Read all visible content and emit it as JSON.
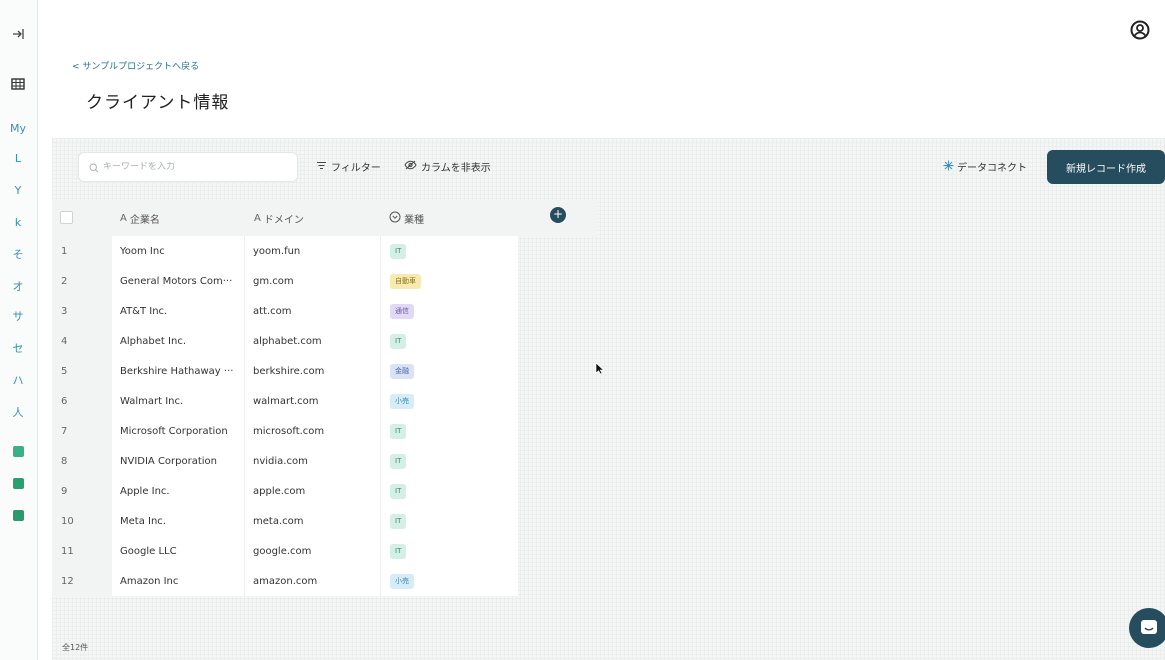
{
  "sidebar": {
    "items": [
      {
        "label": "My",
        "color": "#3a8fb0"
      },
      {
        "label": "L",
        "color": "#3a8fb0"
      },
      {
        "label": "Y",
        "color": "#3a8fb0"
      },
      {
        "label": "k",
        "color": "#3a8fb0"
      },
      {
        "label": "そ",
        "color": "#3a8fb0"
      },
      {
        "label": "オ",
        "color": "#3a8fb0"
      },
      {
        "label": "サ",
        "color": "#3a8fb0"
      },
      {
        "label": "セ",
        "color": "#3a8fb0"
      },
      {
        "label": "ハ",
        "color": "#3a8fb0"
      },
      {
        "label": "人",
        "color": "#3a8fb0"
      }
    ],
    "squares": [
      "#3ab08a",
      "#2aa06f",
      "#2a9a6a"
    ]
  },
  "header": {
    "back_link": "< サンプルプロジェクトへ戻る",
    "title": "クライアント情報"
  },
  "toolbar": {
    "search_placeholder": "キーワードを入力",
    "filter_label": "フィルター",
    "hide_columns_label": "カラムを非表示",
    "data_connect_label": "データコネクト",
    "new_record_label": "新規レコード作成"
  },
  "table": {
    "columns": [
      "企業名",
      "ドメイン",
      "業種"
    ],
    "rows": [
      {
        "num": "1",
        "name": "Yoom Inc",
        "domain": "yoom.fun",
        "industry": "IT",
        "tag_bg": "#d4efe6",
        "tag_fg": "#3a8a73"
      },
      {
        "num": "2",
        "name": "General Motors Com···",
        "domain": "gm.com",
        "industry": "自動車",
        "tag_bg": "#f6eab0",
        "tag_fg": "#8a7520"
      },
      {
        "num": "3",
        "name": "AT&T Inc.",
        "domain": "att.com",
        "industry": "通信",
        "tag_bg": "#e2daf4",
        "tag_fg": "#6b55a8"
      },
      {
        "num": "4",
        "name": "Alphabet Inc.",
        "domain": "alphabet.com",
        "industry": "IT",
        "tag_bg": "#d4efe6",
        "tag_fg": "#3a8a73"
      },
      {
        "num": "5",
        "name": "Berkshire Hathaway ···",
        "domain": "berkshire.com",
        "industry": "金融",
        "tag_bg": "#d9e3f4",
        "tag_fg": "#4a66a0"
      },
      {
        "num": "6",
        "name": "Walmart Inc.",
        "domain": "walmart.com",
        "industry": "小売",
        "tag_bg": "#d6ecf6",
        "tag_fg": "#3a86a6"
      },
      {
        "num": "7",
        "name": "Microsoft Corporation",
        "domain": "microsoft.com",
        "industry": "IT",
        "tag_bg": "#d4efe6",
        "tag_fg": "#3a8a73"
      },
      {
        "num": "8",
        "name": "NVIDIA Corporation",
        "domain": "nvidia.com",
        "industry": "IT",
        "tag_bg": "#d4efe6",
        "tag_fg": "#3a8a73"
      },
      {
        "num": "9",
        "name": "Apple Inc.",
        "domain": "apple.com",
        "industry": "IT",
        "tag_bg": "#d4efe6",
        "tag_fg": "#3a8a73"
      },
      {
        "num": "10",
        "name": "Meta Inc.",
        "domain": "meta.com",
        "industry": "IT",
        "tag_bg": "#d4efe6",
        "tag_fg": "#3a8a73"
      },
      {
        "num": "11",
        "name": "Google LLC",
        "domain": "google.com",
        "industry": "IT",
        "tag_bg": "#d4efe6",
        "tag_fg": "#3a8a73"
      },
      {
        "num": "12",
        "name": "Amazon Inc",
        "domain": "amazon.com",
        "industry": "小売",
        "tag_bg": "#d6ecf6",
        "tag_fg": "#3a86a6"
      }
    ]
  },
  "footer": {
    "count": "全12件"
  },
  "colors": {
    "accent": "#264d5e"
  }
}
